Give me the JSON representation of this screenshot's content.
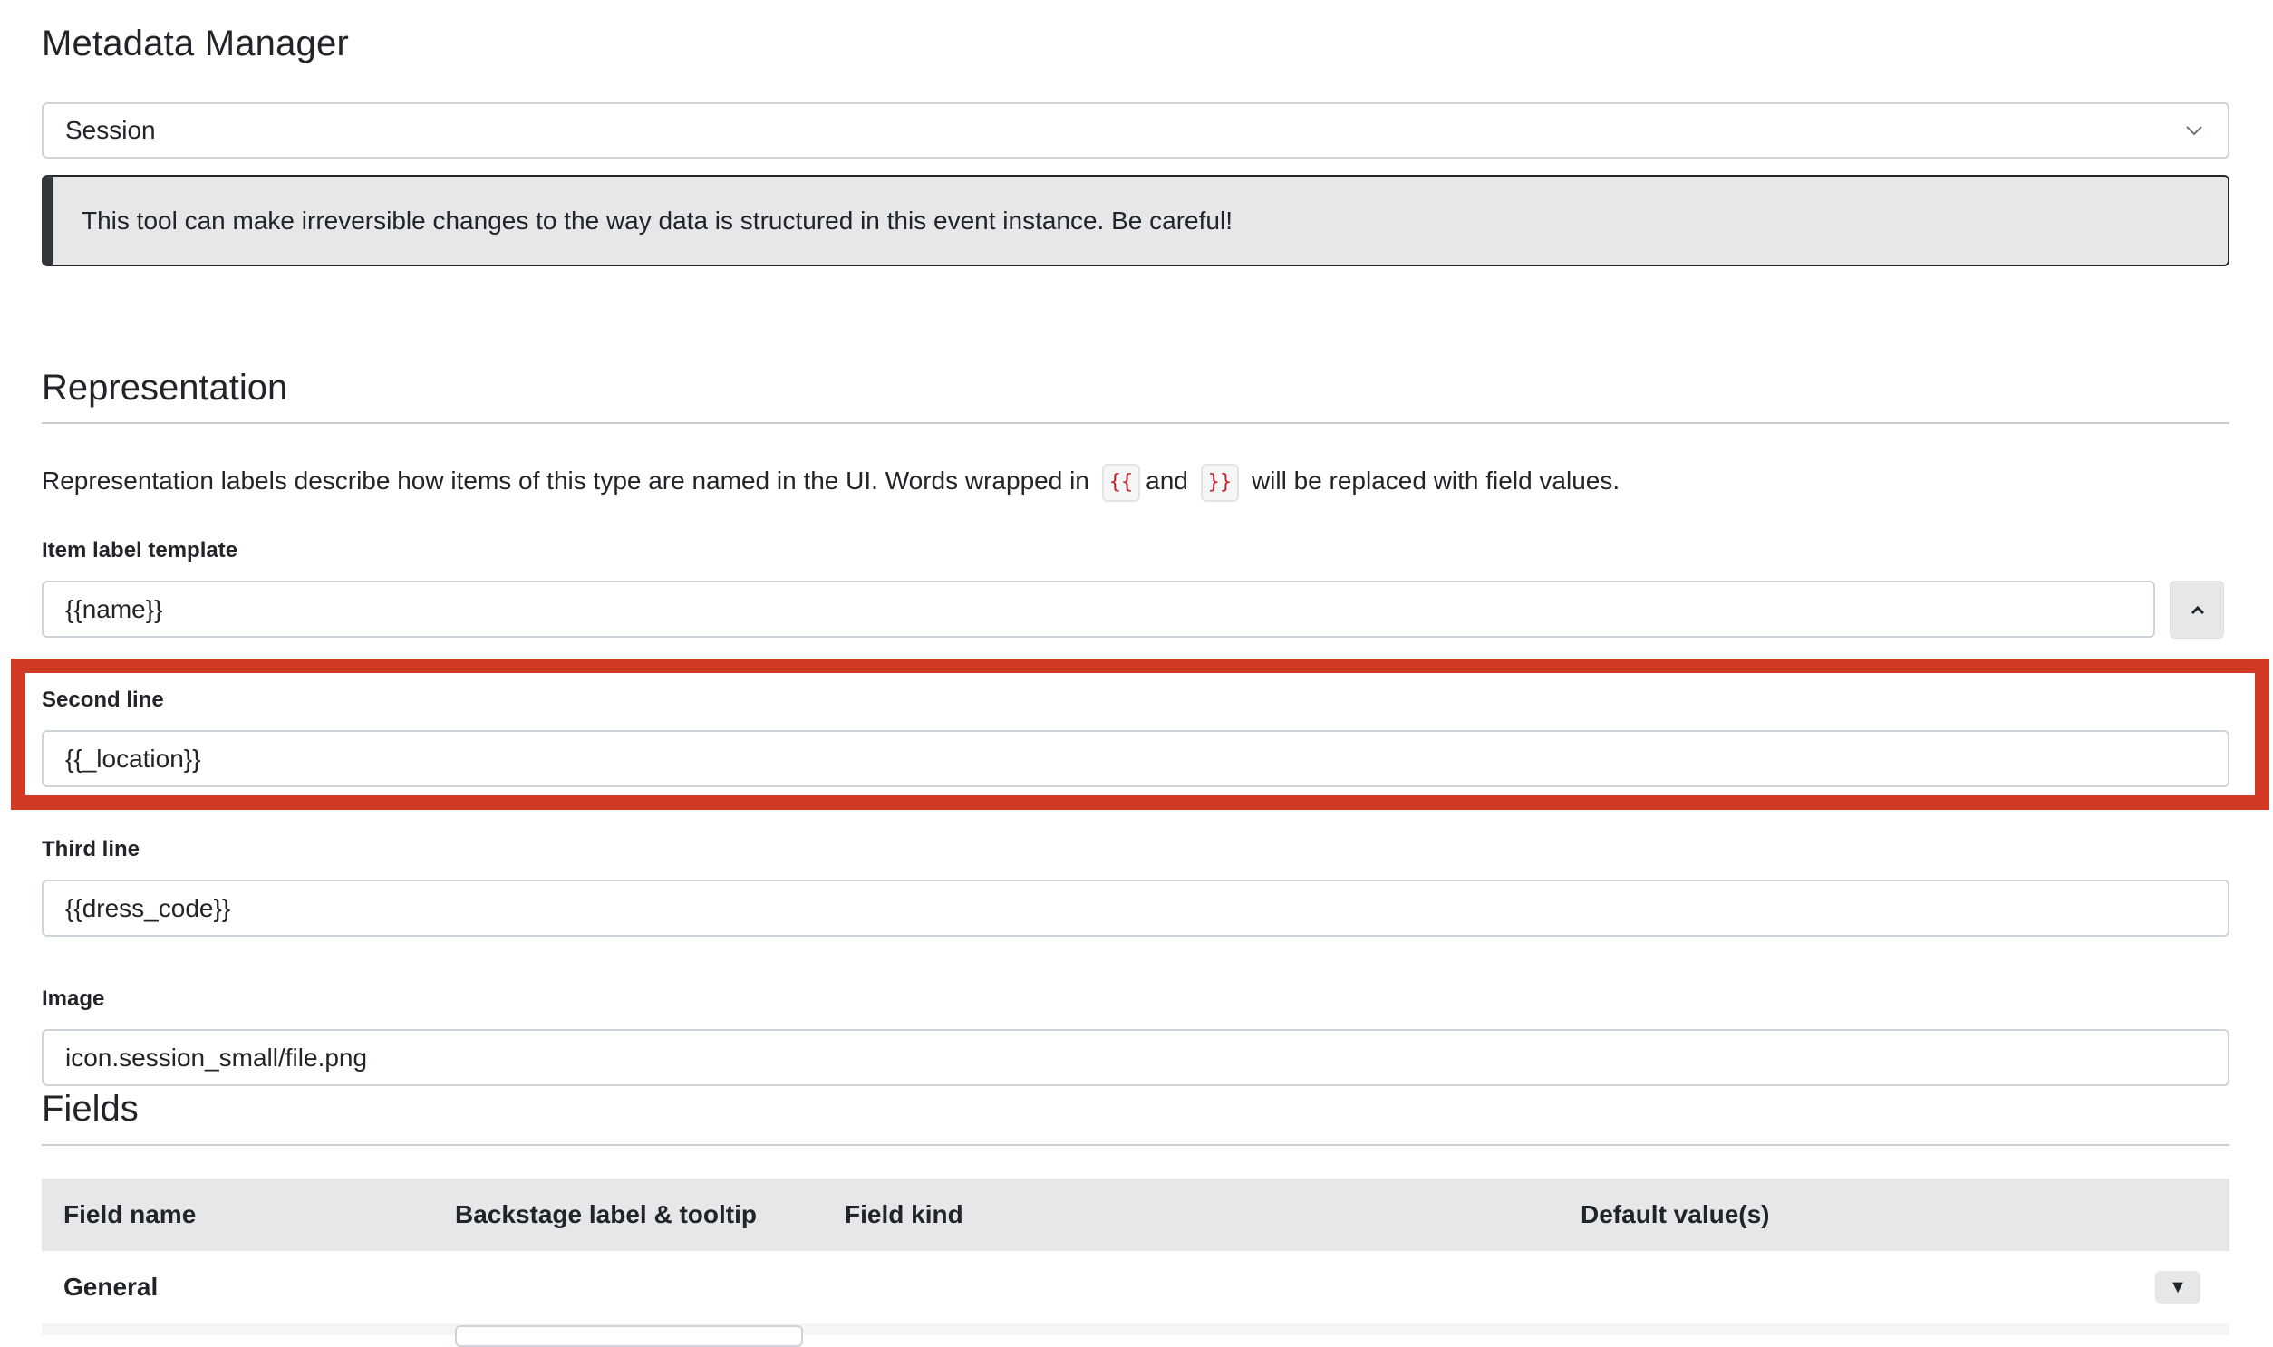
{
  "page": {
    "title": "Metadata Manager"
  },
  "type_select": {
    "value": "Session"
  },
  "alert": {
    "text": "This tool can make irreversible changes to the way data is structured in this event instance. Be careful!"
  },
  "representation": {
    "title": "Representation",
    "description": {
      "before": "Representation labels describe how items of this type are named in the UI. Words wrapped in",
      "open_token": "{{",
      "and": "and",
      "close_token": "}}",
      "after": "will be replaced with field values."
    },
    "item_label": {
      "label": "Item label template",
      "value": "{{name}}"
    },
    "second_line": {
      "label": "Second line",
      "value": "{{_location}}"
    },
    "third_line": {
      "label": "Third line",
      "value": "{{dress_code}}"
    },
    "image": {
      "label": "Image",
      "value": "icon.session_small/file.png"
    }
  },
  "fields": {
    "title": "Fields",
    "columns": [
      "Field name",
      "Backstage label & tooltip",
      "Field kind",
      "Default value(s)"
    ],
    "groups": [
      {
        "name": "General",
        "toggle": "▼"
      }
    ]
  },
  "colors": {
    "highlight": "#d13a25",
    "alert_bg": "#e6e7e9",
    "code_text": "#c0262d"
  },
  "icons": {
    "select_chevron": "chevron-down-icon",
    "collapse": "chevron-up-icon"
  }
}
